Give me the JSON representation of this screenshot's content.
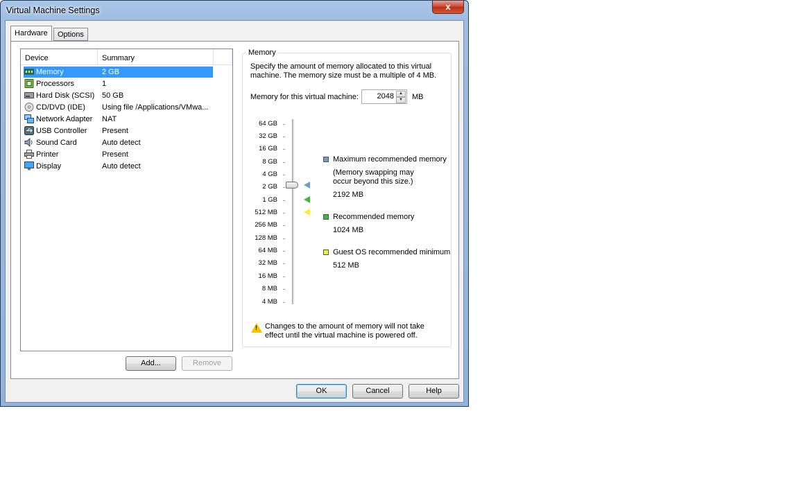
{
  "window": {
    "title": "Virtual Machine Settings",
    "close_label": "x"
  },
  "tabs": [
    {
      "label": "Hardware",
      "active": true
    },
    {
      "label": "Options",
      "active": false
    }
  ],
  "device_list": {
    "columns": [
      "Device",
      "Summary"
    ],
    "rows": [
      {
        "device": "Memory",
        "summary": "2 GB",
        "icon": "memory-icon",
        "selected": true
      },
      {
        "device": "Processors",
        "summary": "1",
        "icon": "processor-icon"
      },
      {
        "device": "Hard Disk (SCSI)",
        "summary": "50 GB",
        "icon": "hard-disk-icon"
      },
      {
        "device": "CD/DVD (IDE)",
        "summary": "Using file /Applications/VMwa...",
        "icon": "cd-dvd-icon"
      },
      {
        "device": "Network Adapter",
        "summary": "NAT",
        "icon": "network-adapter-icon"
      },
      {
        "device": "USB Controller",
        "summary": "Present",
        "icon": "usb-icon"
      },
      {
        "device": "Sound Card",
        "summary": "Auto detect",
        "icon": "sound-card-icon"
      },
      {
        "device": "Printer",
        "summary": "Present",
        "icon": "printer-icon"
      },
      {
        "device": "Display",
        "summary": "Auto detect",
        "icon": "display-icon"
      }
    ]
  },
  "list_buttons": {
    "add": "Add...",
    "remove": "Remove"
  },
  "memory": {
    "group_title": "Memory",
    "description": "Specify the amount of memory allocated to this virtual machine. The memory size must be a multiple of 4 MB.",
    "field_label": "Memory for this virtual machine:",
    "value": "2048",
    "unit": "MB",
    "scale_labels": [
      "64 GB",
      "32 GB",
      "16 GB",
      "8 GB",
      "4 GB",
      "2 GB",
      "1 GB",
      "512 MB",
      "256 MB",
      "128 MB",
      "64 MB",
      "32 MB",
      "16 MB",
      "8 MB",
      "4 MB"
    ],
    "legend": {
      "max": {
        "title": "Maximum recommended memory",
        "note": "(Memory swapping may occur beyond this size.)",
        "value": "2192 MB",
        "color": "#6b9bd1"
      },
      "recommended": {
        "title": "Recommended memory",
        "value": "1024 MB",
        "color": "#3cb83c"
      },
      "guest_min": {
        "title": "Guest OS recommended minimum",
        "value": "512 MB",
        "color": "#f5f032"
      }
    },
    "warning": "Changes to the amount of memory will not take effect until the virtual machine is powered off."
  },
  "dialog_buttons": {
    "ok": "OK",
    "cancel": "Cancel",
    "help": "Help"
  }
}
